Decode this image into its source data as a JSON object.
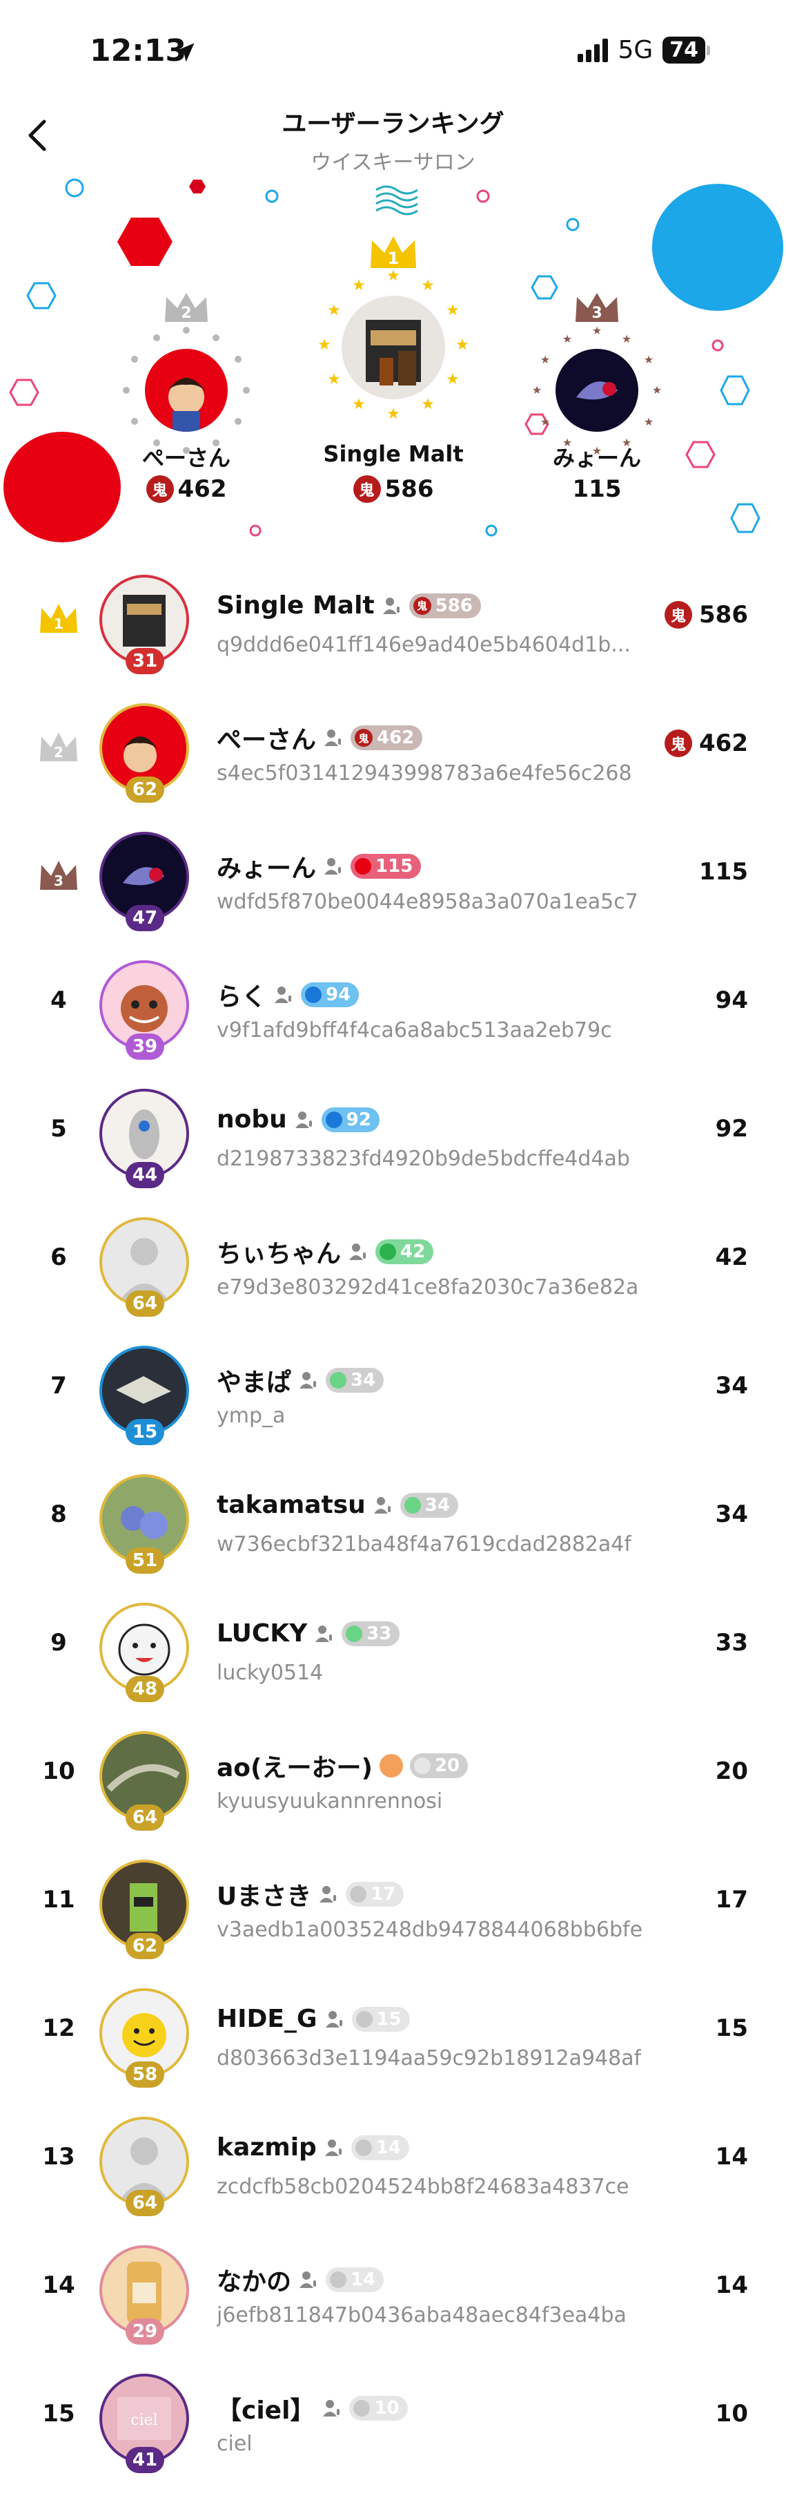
{
  "status_bar": {
    "time": "12:13",
    "network": "5G",
    "battery": "74"
  },
  "header": {
    "title": "ユーザーランキング",
    "subtitle": "ウイスキーサロン"
  },
  "colors": {
    "gold": "#f5c400",
    "silver": "#b8b8b8",
    "bronze": "#8a5a50",
    "oni_red": "#b71c1c",
    "blue_hex": "#1ba7e8",
    "red_blob": "#e60012"
  },
  "podium": [
    {
      "place": "2",
      "name": "ぺーさん",
      "score": "462",
      "oni": "鬼"
    },
    {
      "place": "1",
      "name": "Single Malt",
      "score": "586",
      "oni": "鬼"
    },
    {
      "place": "3",
      "name": "みょーん",
      "score": "115",
      "oni": ""
    }
  ],
  "rows": [
    {
      "rank": "1",
      "name": "Single Malt",
      "pill": "586",
      "pill_icon": "鬼",
      "sub": "q9ddd6e041ff146e9ad40e5b4604d1b...",
      "score": "586",
      "oni": "鬼",
      "level": "31"
    },
    {
      "rank": "2",
      "name": "ぺーさん",
      "pill": "462",
      "pill_icon": "鬼",
      "sub": "s4ec5f031412943998783a6e4fe56c268",
      "score": "462",
      "oni": "鬼",
      "level": "62"
    },
    {
      "rank": "3",
      "name": "みょーん",
      "pill": "115",
      "pill_icon": "",
      "sub": "wdfd5f870be0044e8958a3a070a1ea5c7",
      "score": "115",
      "oni": "",
      "level": "47"
    },
    {
      "rank": "4",
      "name": "らく",
      "pill": "94",
      "pill_icon": "",
      "sub": "v9f1afd9bff4f4ca6a8abc513aa2eb79c",
      "score": "94",
      "oni": "",
      "level": "39"
    },
    {
      "rank": "5",
      "name": "nobu",
      "pill": "92",
      "pill_icon": "",
      "sub": "d2198733823fd4920b9de5bdcffe4d4ab",
      "score": "92",
      "oni": "",
      "level": "44"
    },
    {
      "rank": "6",
      "name": "ちぃちゃん",
      "pill": "42",
      "pill_icon": "",
      "sub": "e79d3e803292d41ce8fa2030c7a36e82a",
      "score": "42",
      "oni": "",
      "level": "64"
    },
    {
      "rank": "7",
      "name": "やまぱ",
      "pill": "34",
      "pill_icon": "",
      "sub": "ymp_a",
      "score": "34",
      "oni": "",
      "level": "15"
    },
    {
      "rank": "8",
      "name": "takamatsu",
      "pill": "34",
      "pill_icon": "",
      "sub": "w736ecbf321ba48f4a7619cdad2882a4f",
      "score": "34",
      "oni": "",
      "level": "51"
    },
    {
      "rank": "9",
      "name": "LUCKY",
      "pill": "33",
      "pill_icon": "",
      "sub": "lucky0514",
      "score": "33",
      "oni": "",
      "level": "48"
    },
    {
      "rank": "10",
      "name": "ao(えーおー)",
      "pill": "20",
      "pill_icon": "",
      "sub": "kyuusyuukannrennosi",
      "score": "20",
      "oni": "",
      "level": "64"
    },
    {
      "rank": "11",
      "name": "Uまさき",
      "pill": "17",
      "pill_icon": "",
      "sub": "v3aedb1a0035248db9478844068bb6bfe",
      "score": "17",
      "oni": "",
      "level": "62"
    },
    {
      "rank": "12",
      "name": "HIDE_G",
      "pill": "15",
      "pill_icon": "",
      "sub": "d803663d3e1194aa59c92b18912a948af",
      "score": "15",
      "oni": "",
      "level": "58"
    },
    {
      "rank": "13",
      "name": "kazmip",
      "pill": "14",
      "pill_icon": "",
      "sub": "zcdcfb58cb0204524bb8f24683a4837ce",
      "score": "14",
      "oni": "",
      "level": "64"
    },
    {
      "rank": "14",
      "name": "なかの",
      "pill": "14",
      "pill_icon": "",
      "sub": "j6efb811847b0436aba48aec84f3ea4ba",
      "score": "14",
      "oni": "",
      "level": "29"
    },
    {
      "rank": "15",
      "name": "【ciel】",
      "pill": "10",
      "pill_icon": "",
      "sub": "ciel",
      "score": "10",
      "oni": "",
      "level": "41"
    }
  ]
}
